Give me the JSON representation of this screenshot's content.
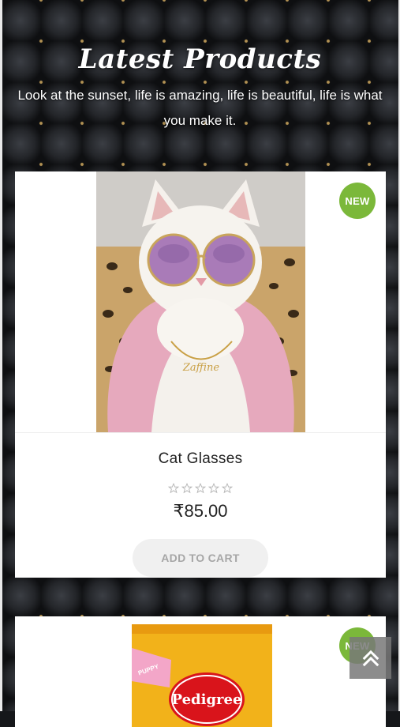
{
  "hero": {
    "title": "Latest Products",
    "subtitle": "Look at the sunset, life is amazing, life is beautiful, life is what you make it."
  },
  "products": [
    {
      "badge": "NEW",
      "name": "Cat Glasses",
      "rating": 0,
      "rating_max": 5,
      "price": "₹85.00",
      "add_to_cart_label": "ADD TO CART",
      "image_text": "Zaffine"
    },
    {
      "badge": "NEW",
      "brand_text": "Pedigree",
      "tag_text": "PUPPY"
    }
  ],
  "colors": {
    "badge": "#7bb83a",
    "button_bg": "#f0f0f0",
    "button_text": "#a6a6a6"
  },
  "icons": {
    "scroll_top": "double-chevron-up-icon",
    "star": "star-outline-icon"
  }
}
